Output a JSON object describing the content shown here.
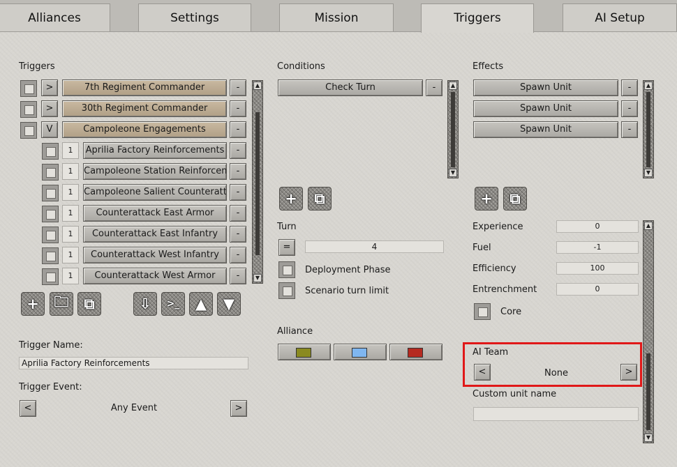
{
  "tabs": [
    {
      "label": "Alliances"
    },
    {
      "label": "Settings"
    },
    {
      "label": "Mission"
    },
    {
      "label": "Triggers"
    },
    {
      "label": "AI Setup"
    }
  ],
  "triggers": {
    "heading": "Triggers",
    "remove_label": "-",
    "items": [
      {
        "toggle": ">",
        "label": "7th Regiment Commander"
      },
      {
        "toggle": ">",
        "label": "30th Regiment Commander"
      },
      {
        "toggle": "V",
        "label": "Campoleone Engagements"
      }
    ],
    "children": [
      {
        "order": "1",
        "label": "Aprilia Factory Reinforcements"
      },
      {
        "order": "1",
        "label": "Campoleone Station Reinforcements"
      },
      {
        "order": "1",
        "label": "Campoleone Salient Counterattack"
      },
      {
        "order": "1",
        "label": "Counterattack East Armor"
      },
      {
        "order": "1",
        "label": "Counterattack East Infantry"
      },
      {
        "order": "1",
        "label": "Counterattack West Infantry"
      },
      {
        "order": "1",
        "label": "Counterattack West Armor"
      }
    ],
    "toolbar_icons": [
      "add-icon",
      "folder-icon",
      "copy-icon",
      "import-icon",
      "console-icon",
      "arrow-up-icon",
      "arrow-down-icon"
    ],
    "name_label": "Trigger Name:",
    "name_value": "Aprilia Factory Reinforcements",
    "event_label": "Trigger Event:",
    "event_value": "Any Event",
    "event_prev": "<",
    "event_next": ">"
  },
  "conditions": {
    "heading": "Conditions",
    "items": [
      {
        "label": "Check Turn"
      }
    ],
    "remove_label": "-"
  },
  "turn": {
    "heading": "Turn",
    "operator": "=",
    "value": "4",
    "deployment_phase": "Deployment Phase",
    "scenario_turn_limit": "Scenario turn limit"
  },
  "alliance": {
    "heading": "Alliance",
    "colors": [
      "#8a8a20",
      "#7fb6f0",
      "#b52a20"
    ]
  },
  "effects": {
    "heading": "Effects",
    "items": [
      {
        "label": "Spawn Unit"
      },
      {
        "label": "Spawn Unit"
      },
      {
        "label": "Spawn Unit"
      }
    ],
    "remove_label": "-"
  },
  "unit": {
    "experience_label": "Experience",
    "experience": "0",
    "fuel_label": "Fuel",
    "fuel": "-1",
    "efficiency_label": "Efficiency",
    "efficiency": "100",
    "entrenchment_label": "Entrenchment",
    "entrenchment": "0",
    "core_label": "Core",
    "ai_team_label": "AI Team",
    "ai_team_value": "None",
    "ai_team_prev": "<",
    "ai_team_next": ">",
    "custom_name_label": "Custom unit name",
    "custom_name_value": ""
  },
  "highlight_color": "#e01818"
}
